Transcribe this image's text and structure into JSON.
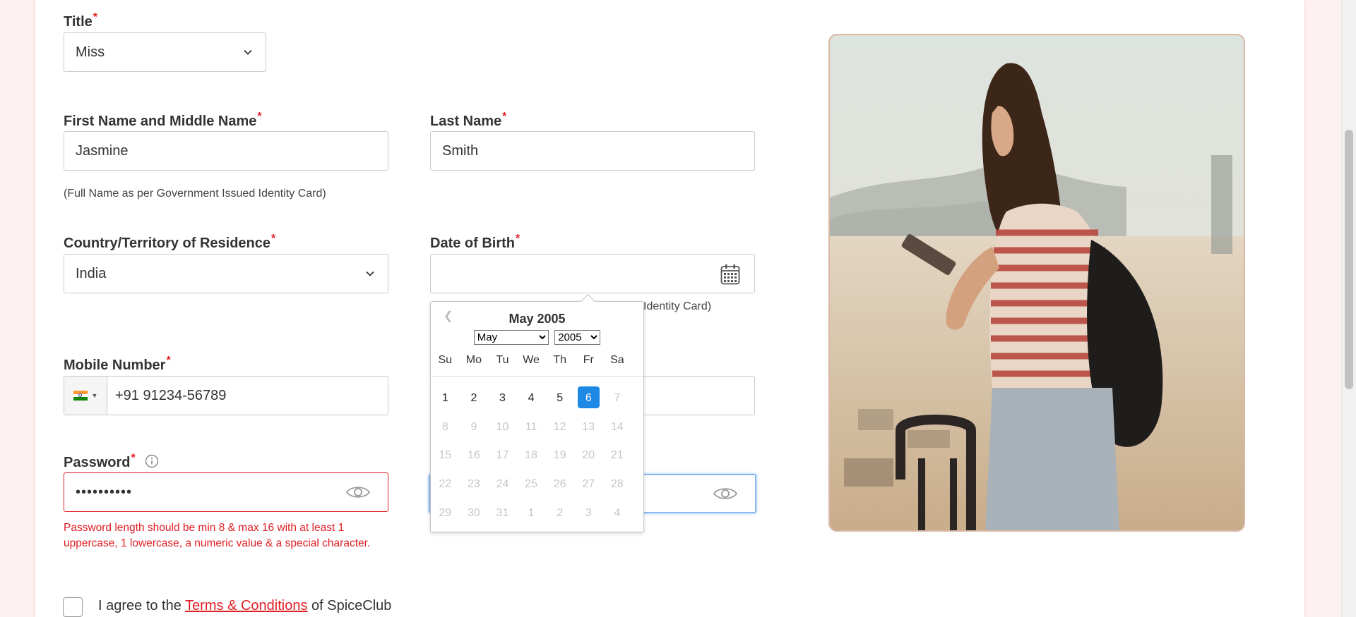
{
  "form": {
    "title": {
      "label": "Title",
      "value": "Miss"
    },
    "first_name": {
      "label": "First Name and Middle Name",
      "value": "Jasmine"
    },
    "last_name": {
      "label": "Last Name",
      "value": "Smith"
    },
    "name_hint": "(Full Name as per Government Issued Identity Card)",
    "country": {
      "label": "Country/Territory of Residence",
      "value": "India"
    },
    "dob": {
      "label": "Date of Birth",
      "value": "",
      "hint_partial": "Identity Card)"
    },
    "mobile": {
      "label": "Mobile Number",
      "value": "+91 91234-56789"
    },
    "password": {
      "label": "Password",
      "value": "••••••••••",
      "error": "Password length should be min 8 & max 16 with at least 1 uppercase, 1 lowercase, a numeric value & a special character."
    },
    "terms": {
      "prefix": "I agree to the ",
      "link": "Terms & Conditions",
      "suffix": " of SpiceClub"
    },
    "required_mark": "*"
  },
  "datepicker": {
    "title": "May 2005",
    "month_select": "May",
    "year_select": "2005",
    "weekdays": [
      "Su",
      "Mo",
      "Tu",
      "We",
      "Th",
      "Fr",
      "Sa"
    ],
    "weeks": [
      [
        "1",
        "2",
        "3",
        "4",
        "5",
        "6",
        "7"
      ],
      [
        "8",
        "9",
        "10",
        "11",
        "12",
        "13",
        "14"
      ],
      [
        "15",
        "16",
        "17",
        "18",
        "19",
        "20",
        "21"
      ],
      [
        "22",
        "23",
        "24",
        "25",
        "26",
        "27",
        "28"
      ],
      [
        "29",
        "30",
        "31",
        "1",
        "2",
        "3",
        "4"
      ]
    ],
    "selected": "6"
  },
  "colors": {
    "accent": "#e01e24",
    "selected_day": "#1e88e5"
  }
}
